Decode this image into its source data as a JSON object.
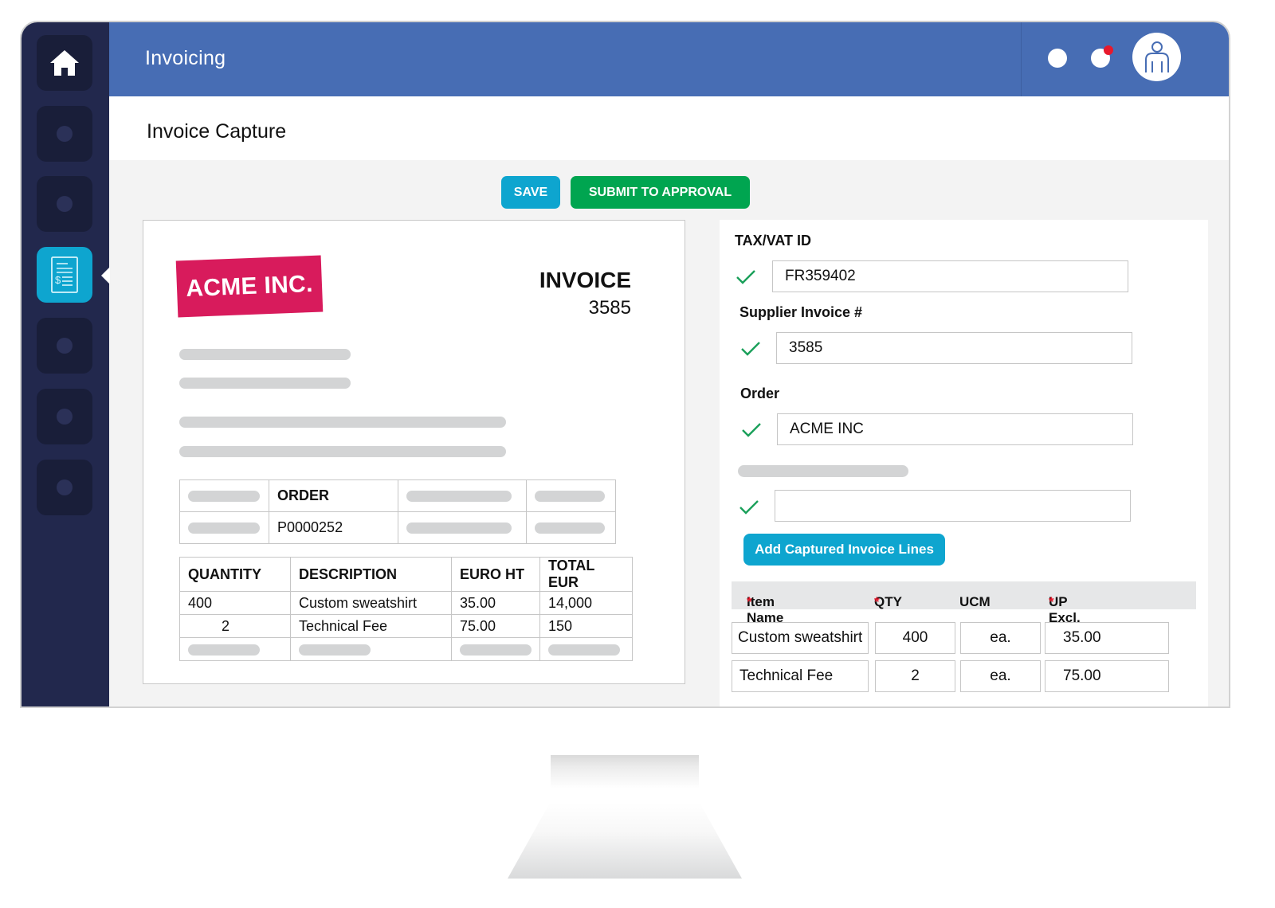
{
  "header": {
    "app_title": "Invoicing",
    "icons": [
      "home-icon",
      "invoice-dollar-icon",
      "notification-dot-icon",
      "user-avatar-icon"
    ]
  },
  "page": {
    "title": "Invoice Capture"
  },
  "toolbar": {
    "save_label": "SAVE",
    "submit_label": "SUBMIT TO APPROVAL"
  },
  "document": {
    "company": "ACME INC.",
    "doc_type": "INVOICE",
    "doc_number": "3585",
    "order_table": {
      "header": "ORDER",
      "value": "P0000252"
    },
    "lines_table": {
      "columns": [
        "QUANTITY",
        "DESCRIPTION",
        "EURO HT",
        "TOTAL EUR"
      ],
      "rows": [
        [
          "400",
          "Custom sweatshirt",
          "35.00",
          "14,000"
        ],
        [
          "2",
          "Technical Fee",
          "75.00",
          "150"
        ]
      ]
    }
  },
  "form": {
    "fields": [
      {
        "label": "TAX/VAT ID",
        "value": "FR359402",
        "validated": true
      },
      {
        "label": "Supplier Invoice #",
        "value": "3585",
        "validated": true
      },
      {
        "label": "Order",
        "value": "ACME INC",
        "validated": true
      },
      {
        "label": "",
        "value": "",
        "validated": true
      }
    ],
    "add_lines_label": "Add Captured Invoice Lines",
    "lines": {
      "columns": [
        {
          "label": "Item Name",
          "required": "*"
        },
        {
          "label": "QTY",
          "required": "*"
        },
        {
          "label": "UCM",
          "required": ""
        },
        {
          "label": "UP Excl. Tax",
          "required": "*"
        }
      ],
      "rows": [
        {
          "item": "Custom sweatshirt",
          "qty": "400",
          "ucm": "ea.",
          "price": "35.00"
        },
        {
          "item": "Technical Fee",
          "qty": "2",
          "ucm": "ea.",
          "price": "75.00"
        }
      ]
    }
  },
  "colors": {
    "header": "#476db4",
    "sidebar": "#22284d",
    "accent": "#0ea5cf",
    "submit": "#00a550",
    "logo": "#d81b5c",
    "check": "#1aa05a",
    "required": "#e8192c"
  }
}
